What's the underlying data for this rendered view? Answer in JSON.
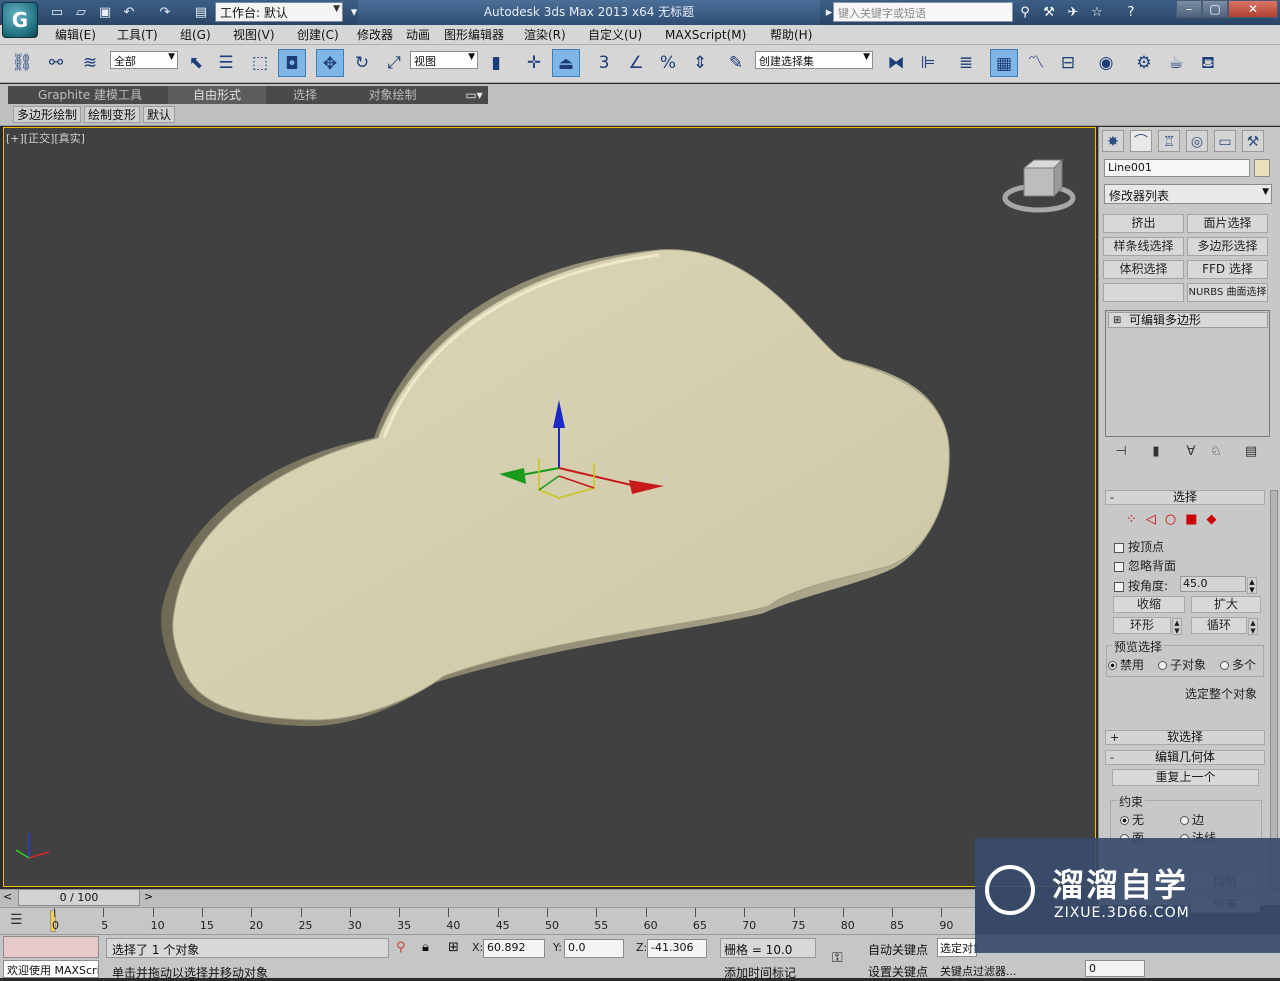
{
  "app": {
    "logo_text": "G",
    "workspace_label": "工作台: 默认",
    "title": "Autodesk 3ds Max  2013 x64      无标题",
    "search_placeholder": "键入关键字或短语"
  },
  "menu": [
    "编辑(E)",
    "工具(T)",
    "组(G)",
    "视图(V)",
    "创建(C)",
    "修改器",
    "动画",
    "图形编辑器",
    "渲染(R)",
    "自定义(U)",
    "MAXScript(M)",
    "帮助(H)"
  ],
  "toolbar": {
    "selection_filter": "全部",
    "ref_coord": "视图",
    "named_selection": "创建选择集",
    "snap_label": "3",
    "percent_label": "%"
  },
  "ribbon": {
    "tabs": [
      "Graphite 建模工具",
      "自由形式",
      "选择",
      "对象绘制"
    ],
    "active_tab": 1,
    "subtabs": [
      "多边形绘制",
      "绘制变形",
      "默认"
    ]
  },
  "viewport": {
    "label": "[+][正交][真实]",
    "gizmo_axes": {
      "z": "z",
      "x": "x"
    },
    "object_color": "#d3cdae"
  },
  "command_panel": {
    "object_name": "Line001",
    "modifier_list": "修改器列表",
    "modifier_buttons": [
      "挤出",
      "面片选择",
      "样条线选择",
      "多边形选择",
      "体积选择",
      "FFD 选择",
      "",
      "NURBS 曲面选择"
    ],
    "stack_item": "可编辑多边形",
    "selection_rollout": {
      "title": "选择",
      "checkboxes": [
        "按顶点",
        "忽略背面",
        "按角度:"
      ],
      "angle_value": "45.0",
      "shrink": "收缩",
      "grow": "扩大",
      "ring": "环形",
      "loop": "循环",
      "preview_label": "预览选择",
      "preview_options": [
        "禁用",
        "子对象",
        "多个"
      ],
      "select_whole": "选定整个对象"
    },
    "soft_selection": "软选择",
    "edit_geometry": "编辑几何体",
    "repeat_last": "重复上一个",
    "constraints_label": "约束",
    "constraints": [
      "无",
      "边",
      "面",
      "法线"
    ],
    "extra_buttons": [
      "塌陷",
      "分离"
    ]
  },
  "timeline": {
    "frame_display": "0 / 100",
    "ticks": [
      "0",
      "5",
      "10",
      "15",
      "20",
      "25",
      "30",
      "35",
      "40",
      "45",
      "50",
      "55",
      "60",
      "65",
      "70",
      "75",
      "80",
      "85",
      "90"
    ]
  },
  "status": {
    "welcome": "欢迎使用 MAXScri",
    "selected": "选择了 1 个对象",
    "prompt": "单击并拖动以选择并移动对象",
    "x": "60.892",
    "y": "0.0",
    "z": "-41.306",
    "grid": "栅格 = 10.0",
    "auto_key": "自动关键点",
    "set_key": "设置关键点",
    "selected_obj": "选定对象",
    "key_filter": "关键点过滤器...",
    "add_time_tag": "添加时间标记",
    "frame_field": "0"
  },
  "watermark": {
    "title": "溜溜自学",
    "url": "ZIXUE.3D66.COM"
  }
}
